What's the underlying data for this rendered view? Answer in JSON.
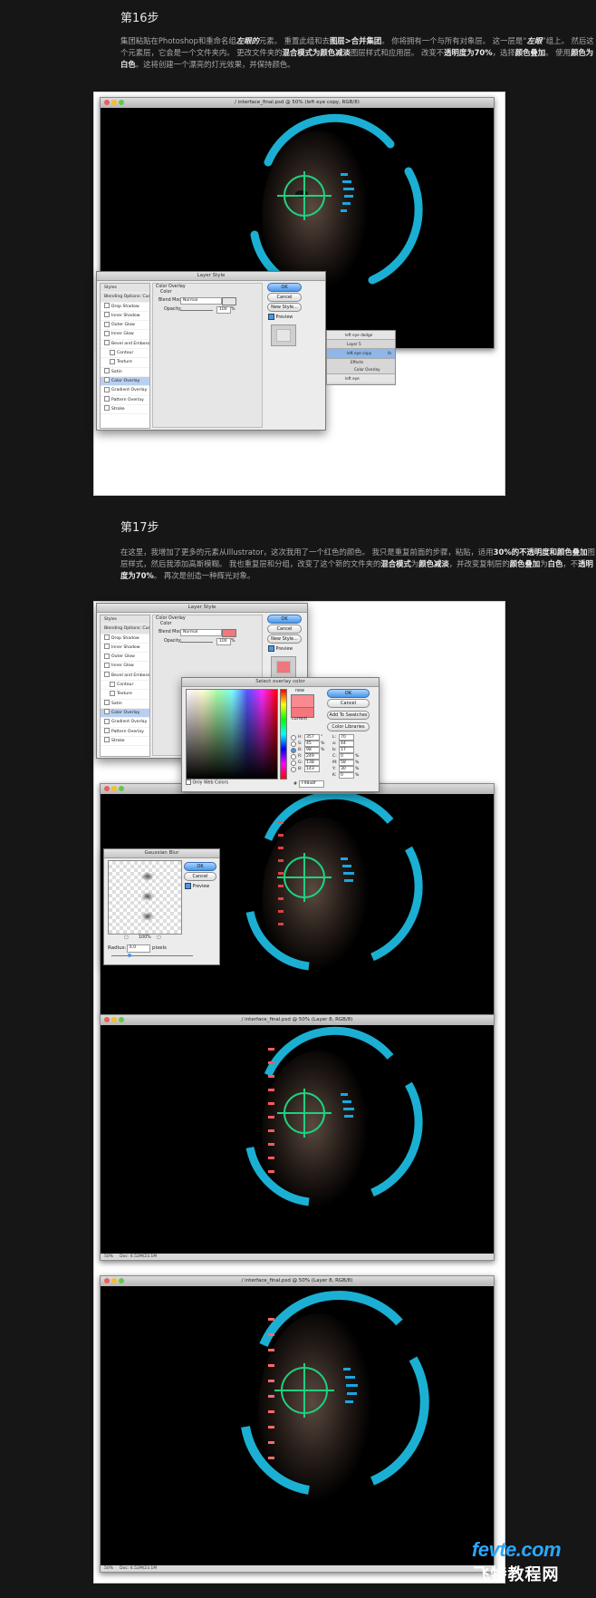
{
  "step16": {
    "title": "第16步",
    "paragraph": [
      {
        "t": "集团粘贴在Photoshop和重命名组"
      },
      {
        "t": "左眼的",
        "b": true,
        "i": true
      },
      {
        "t": "元素。 重置此组和去"
      },
      {
        "t": "图层>合并集团",
        "b": true
      },
      {
        "t": "。 你将拥有一个与所有对象层。 这一层是“"
      },
      {
        "t": "左眼",
        "b": true,
        "i": true
      },
      {
        "t": "”组上。 然后这个元素层，它会是一个文件夹内。 更改文件夹的"
      },
      {
        "t": "混合模式为颜色减淡",
        "b": true
      },
      {
        "t": "图层样式和应用层。 改变不"
      },
      {
        "t": "透明度为70%",
        "b": true
      },
      {
        "t": "，选择"
      },
      {
        "t": "颜色叠加",
        "b": true
      },
      {
        "t": "。 使用"
      },
      {
        "t": "颜色为白色",
        "b": true
      },
      {
        "t": "。这将创建一个漂亮的灯光效果，并保持颜色。"
      }
    ],
    "window_title": "/ interface_final.psd @ 50% (left eye copy, RGB/8)",
    "layer_style": {
      "title": "Layer Style",
      "styles": [
        "Styles",
        "Blending Options: Custom",
        "Drop Shadow",
        "Inner Shadow",
        "Outer Glow",
        "Inner Glow",
        "Bevel and Emboss",
        "Contour",
        "Texture",
        "Satin",
        "Color Overlay",
        "Gradient Overlay",
        "Pattern Overlay",
        "Stroke"
      ],
      "group": "Color Overlay",
      "subgroup": "Color",
      "blend_label": "Blend Mode:",
      "blend_value": "Normal",
      "opacity_label": "Opacity:",
      "opacity_value": "100",
      "percent": "%",
      "ok": "OK",
      "cancel": "Cancel",
      "new_style": "New Style...",
      "preview": "Preview",
      "swatch_color": "#e6e6e6"
    },
    "layers": [
      "left eye dodge",
      "Layer 5",
      "left eye copy",
      "Effects",
      "Color Overlay",
      "left eye"
    ],
    "layers_fx": "fx"
  },
  "step17": {
    "title": "第17步",
    "paragraph": [
      {
        "t": "在这里，我增加了更多的元素从Illustrator，这次我用了一个红色的颜色。 我只是重复前面的步骤，粘贴，适用"
      },
      {
        "t": "30%的不透明度和颜色叠加",
        "b": true
      },
      {
        "t": "图层样式，然后我添加高斯模糊。 我也重复层和分组，改变了这个新的文件夹的"
      },
      {
        "t": "混合模式",
        "b": true
      },
      {
        "t": "为"
      },
      {
        "t": "颜色减淡",
        "b": true
      },
      {
        "t": "，并改变复制层的"
      },
      {
        "t": "颜色叠加",
        "b": true
      },
      {
        "t": "为"
      },
      {
        "t": "白色",
        "b": true
      },
      {
        "t": "，不"
      },
      {
        "t": "透明度为70%",
        "b": true
      },
      {
        "t": "。 再次是创造一种辉光对象。"
      }
    ],
    "layer_style": {
      "title": "Layer Style",
      "group": "Color Overlay",
      "subgroup": "Color",
      "blend_label": "Blend Mode:",
      "blend_value": "Normal",
      "opacity_label": "Opacity:",
      "opacity_value": "100",
      "percent": "%",
      "ok": "OK",
      "cancel": "Cancel",
      "new_style": "New Style...",
      "preview": "Preview",
      "swatch_color": "#f0777c"
    },
    "color_picker": {
      "title": "Select overlay color",
      "new_label": "new",
      "current_label": "current",
      "ok": "OK",
      "cancel": "Cancel",
      "add_swatches": "Add To Swatches",
      "color_libraries": "Color Libraries",
      "only_web": "Only Web Colors",
      "hex_label": "#",
      "hex": "F98a8f",
      "fields": [
        {
          "l": "H:",
          "v": "357",
          "u": "°"
        },
        {
          "l": "S:",
          "v": "45",
          "u": "%"
        },
        {
          "l": "B:",
          "v": "98",
          "u": "%"
        },
        {
          "l": "R:",
          "v": "249",
          "u": ""
        },
        {
          "l": "G:",
          "v": "138",
          "u": ""
        },
        {
          "l": "B:",
          "v": "143",
          "u": ""
        }
      ],
      "fields_right": [
        {
          "l": "L:",
          "v": "70",
          "u": ""
        },
        {
          "l": "a:",
          "v": "44",
          "u": ""
        },
        {
          "l": "b:",
          "v": "17",
          "u": ""
        },
        {
          "l": "C:",
          "v": "0",
          "u": "%"
        },
        {
          "l": "M:",
          "v": "58",
          "u": "%"
        },
        {
          "l": "Y:",
          "v": "30",
          "u": "%"
        },
        {
          "l": "K:",
          "v": "0",
          "u": "%"
        }
      ],
      "new_color": "#f98a8f",
      "current_color": "#f4777d"
    },
    "gaussian": {
      "title": "Gaussian Blur",
      "ok": "OK",
      "cancel": "Cancel",
      "preview": "Preview",
      "zoom": "100%",
      "radius_label": "Radius:",
      "radius": "6.0",
      "unit": "pixels"
    },
    "window2_title": "/ interface_final.psd @ 50% (Layer 8, RGB/8)",
    "window3_title": "/ interface_final.psd @ 50% (Layer 8, RGB/8)",
    "status": {
      "zoom": "50%",
      "doc": "Doc: 6.52M/23.1M"
    }
  },
  "watermark": {
    "line1": "fevte.com",
    "line2": "飞特教程网"
  },
  "colors": {
    "cyan": "#19c3e6",
    "green": "#3fd98a",
    "red": "#ff4a4a",
    "accent": "#4b96e8"
  }
}
